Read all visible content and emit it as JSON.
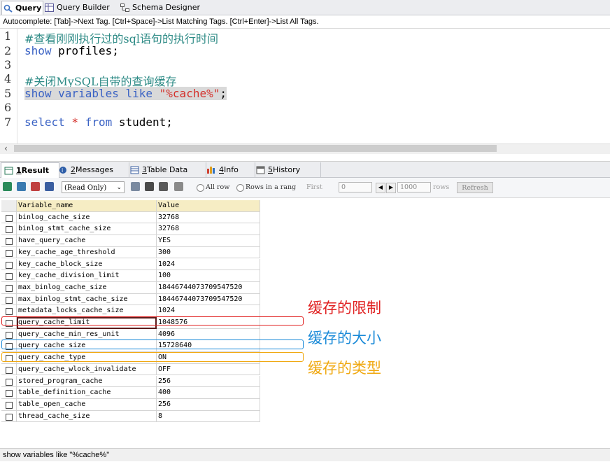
{
  "top_tabs": [
    {
      "label": "Query",
      "icon": "query-icon"
    },
    {
      "label": "Query Builder",
      "icon": "query-builder-icon"
    },
    {
      "label": "Schema Designer",
      "icon": "schema-designer-icon"
    }
  ],
  "autocomplete_hint": "Autocomplete: [Tab]->Next Tag. [Ctrl+Space]->List Matching Tags. [Ctrl+Enter]->List All Tags.",
  "editor": {
    "line_numbers": [
      "1",
      "2",
      "3",
      "4",
      "5",
      "6",
      "7"
    ],
    "lines": {
      "l1_comment": "#查看刚刚执行过的sql语句的执行时间",
      "l2_kw": "show",
      "l2_rest": " profiles;",
      "l4_comment": "#关闭MySQL自带的查询缓存",
      "l5_kw": "show variables like ",
      "l5_str": "\"%cache%\"",
      "l5_end": ";",
      "l7_kw1": "select",
      "l7_star": " * ",
      "l7_kw2": "from",
      "l7_rest": " student;"
    },
    "scroll_left": "‹"
  },
  "result_tabs": [
    {
      "num": "1",
      "label": " Result",
      "icon": "result-icon"
    },
    {
      "num": "2",
      "label": " Messages",
      "icon": "messages-icon"
    },
    {
      "num": "3",
      "label": " Table Data",
      "icon": "table-data-icon"
    },
    {
      "num": "4",
      "label": " Info",
      "icon": "info-icon"
    },
    {
      "num": "5",
      "label": " History",
      "icon": "history-icon"
    }
  ],
  "result_toolbar": {
    "mode_select": "(Read Only)",
    "all_rows": "All row",
    "rows_in_range": "Rows in a rang",
    "first_label": "First",
    "first_value": "0",
    "rows_value": "1000",
    "rows_label": "rows",
    "refresh": "Refresh"
  },
  "grid": {
    "columns": [
      "Variable_name",
      "Value"
    ],
    "rows": [
      [
        "binlog_cache_size",
        "32768"
      ],
      [
        "binlog_stmt_cache_size",
        "32768"
      ],
      [
        "have_query_cache",
        "YES"
      ],
      [
        "key_cache_age_threshold",
        "300"
      ],
      [
        "key_cache_block_size",
        "1024"
      ],
      [
        "key_cache_division_limit",
        "100"
      ],
      [
        "max_binlog_cache_size",
        "18446744073709547520"
      ],
      [
        "max_binlog_stmt_cache_size",
        "18446744073709547520"
      ],
      [
        "metadata_locks_cache_size",
        "1024"
      ],
      [
        "query_cache_limit",
        "1048576"
      ],
      [
        "query_cache_min_res_unit",
        "4096"
      ],
      [
        "query_cache_size",
        "15728640"
      ],
      [
        "query_cache_type",
        "ON"
      ],
      [
        "query_cache_wlock_invalidate",
        "OFF"
      ],
      [
        "stored_program_cache",
        "256"
      ],
      [
        "table_definition_cache",
        "400"
      ],
      [
        "table_open_cache",
        "256"
      ],
      [
        "thread_cache_size",
        "8"
      ]
    ]
  },
  "annotations": {
    "limit": {
      "label": "缓存的限制",
      "color": "#e02020"
    },
    "size": {
      "label": "缓存的大小",
      "color": "#1a8ad8"
    },
    "type": {
      "label": "缓存的类型",
      "color": "#f0a810"
    }
  },
  "status_bar": "show variables like \"%cache%\""
}
